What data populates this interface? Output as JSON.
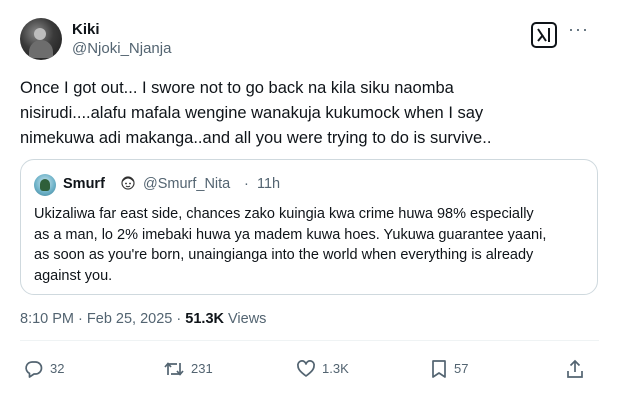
{
  "author": {
    "name": "Kiki",
    "handle": "@Njoki_Njanja"
  },
  "tweet": {
    "text": "Once I got out... I swore not to go back na kila siku naomba\nnisirudi....alafu mafala wengine wanakuja kukumock when I say\nnimekuwa adi makanga..and all you were trying to do is survive.."
  },
  "quote": {
    "name": "Smurf",
    "handle": "@Smurf_Nita",
    "separator": "·",
    "time": "11h",
    "text": "Ukizaliwa far east side, chances zako kuingia kwa crime huwa 98% especially\nas a man, lo 2% imebaki huwa ya madem kuwa hoes. Yukuwa guarantee yaani,\nas soon as you're born, unaingianga into the world when everything is already\nagainst you."
  },
  "meta": {
    "time": "8:10 PM",
    "sep1": "·",
    "date": "Feb 25, 2025",
    "sep2": "·",
    "views_count": "51.3K",
    "views_label": "Views"
  },
  "actions": {
    "replies": "32",
    "reposts": "231",
    "likes": "1.3K",
    "bookmarks": "57"
  },
  "colors": {
    "text": "#0f1419",
    "secondary": "#536471",
    "border": "#cfd9de"
  },
  "icons": [
    "grok-icon",
    "more-icon",
    "reply-icon",
    "repost-icon",
    "like-icon",
    "bookmark-icon",
    "share-icon"
  ]
}
